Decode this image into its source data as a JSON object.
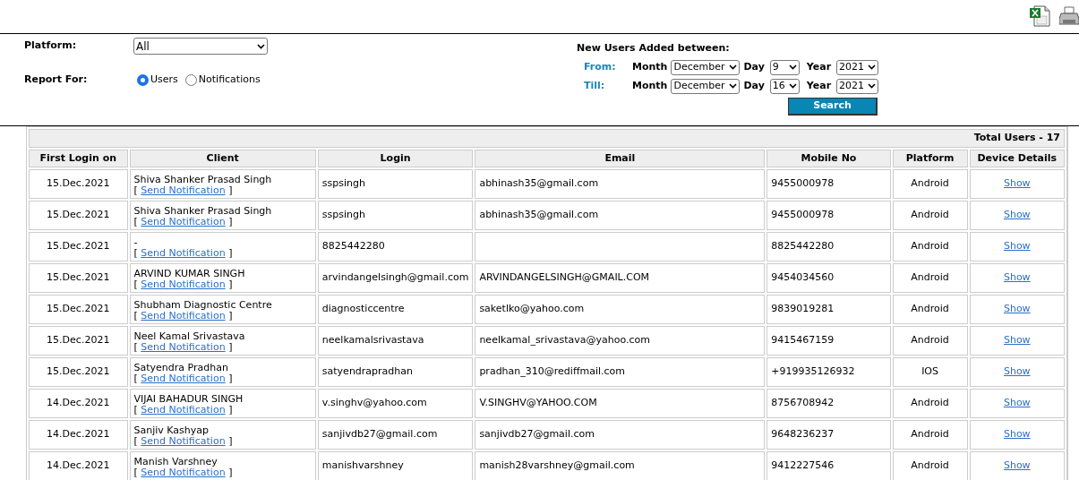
{
  "filters": {
    "platform": {
      "label": "Platform:",
      "value": "All"
    },
    "report_for": {
      "label": "Report For:",
      "options": [
        {
          "label": "Users",
          "selected": true
        },
        {
          "label": "Notifications",
          "selected": false
        }
      ]
    },
    "date_range": {
      "title": "New Users Added between:",
      "rows": [
        {
          "label": "From:",
          "month_label": "Month",
          "month": "December",
          "day_label": "Day",
          "day": "9",
          "year_label": "Year",
          "year": "2021"
        },
        {
          "label": "Till:",
          "month_label": "Month",
          "month": "December",
          "day_label": "Day",
          "day": "16",
          "year_label": "Year",
          "year": "2021"
        }
      ]
    },
    "search_button": "Search"
  },
  "table": {
    "total": "Total Users - 17",
    "columns": [
      "First Login on",
      "Client",
      "Login",
      "Email",
      "Mobile No",
      "Platform",
      "Device Details"
    ],
    "rows": [
      {
        "first_login": "15.Dec.2021",
        "client": "Shiva Shanker Prasad Singh",
        "action": [
          "[",
          "Send Notification",
          "]"
        ],
        "login": "sspsingh",
        "email": "abhinash35@gmail.com",
        "mobile": "9455000978",
        "platform": "Android",
        "details": "Show"
      },
      {
        "first_login": "15.Dec.2021",
        "client": "Shiva Shanker Prasad Singh",
        "action": [
          "[",
          "Send Notification",
          "]"
        ],
        "login": "sspsingh",
        "email": "abhinash35@gmail.com",
        "mobile": "9455000978",
        "platform": "Android",
        "details": "Show"
      },
      {
        "first_login": "15.Dec.2021",
        "client": "-",
        "action": [
          "[",
          "Send Notification",
          "]"
        ],
        "login": "8825442280",
        "mobile": "8825442280",
        "platform": "Android",
        "details": "Show"
      },
      {
        "first_login": "15.Dec.2021",
        "client": "ARVIND KUMAR SINGH",
        "action": [
          "[",
          "Send Notification",
          "]"
        ],
        "login": "arvindangelsingh@gmail.com",
        "email": "ARVINDANGELSINGH@GMAIL.COM",
        "mobile": "9454034560",
        "platform": "Android",
        "details": "Show"
      },
      {
        "first_login": "15.Dec.2021",
        "client": "Shubham Diagnostic Centre",
        "action": [
          "[",
          "Send Notification",
          "]"
        ],
        "login": "diagnosticcentre",
        "email": "saketlko@yahoo.com",
        "mobile": "9839019281",
        "platform": "Android",
        "details": "Show"
      },
      {
        "first_login": "15.Dec.2021",
        "client": "Neel Kamal Srivastava",
        "action": [
          "[",
          "Send Notification",
          "]"
        ],
        "login": "neelkamalsrivastava",
        "email": "neelkamal_srivastava@yahoo.com",
        "mobile": "9415467159",
        "platform": "Android",
        "details": "Show"
      },
      {
        "first_login": "15.Dec.2021",
        "client": "Satyendra Pradhan",
        "action": [
          "[",
          "Send Notification",
          "]"
        ],
        "login": "satyendrapradhan",
        "email": "pradhan_310@rediffmail.com",
        "mobile": "+919935126932",
        "platform": "IOS",
        "details": "Show"
      },
      {
        "first_login": "14.Dec.2021",
        "client": "VIJAI BAHADUR SINGH",
        "action": [
          "[",
          "Send Notification",
          "]"
        ],
        "login": "v.singhv@yahoo.com",
        "email": "V.SINGHV@YAHOO.COM",
        "mobile": "8756708942",
        "platform": "Android",
        "details": "Show"
      },
      {
        "first_login": "14.Dec.2021",
        "client": "Sanjiv Kashyap",
        "action": [
          "[",
          "Send Notification",
          "]"
        ],
        "login": "sanjivdb27@gmail.com",
        "email": "sanjivdb27@gmail.com",
        "mobile": "9648236237",
        "platform": "Android",
        "details": "Show"
      },
      {
        "first_login": "14.Dec.2021",
        "client": "Manish Varshney",
        "action": [
          "[",
          "Send Notification",
          "]"
        ],
        "login": "manishvarshney",
        "email": "manish28varshney@gmail.com",
        "mobile": "9412227546",
        "platform": "Android",
        "details": "Show"
      }
    ]
  }
}
